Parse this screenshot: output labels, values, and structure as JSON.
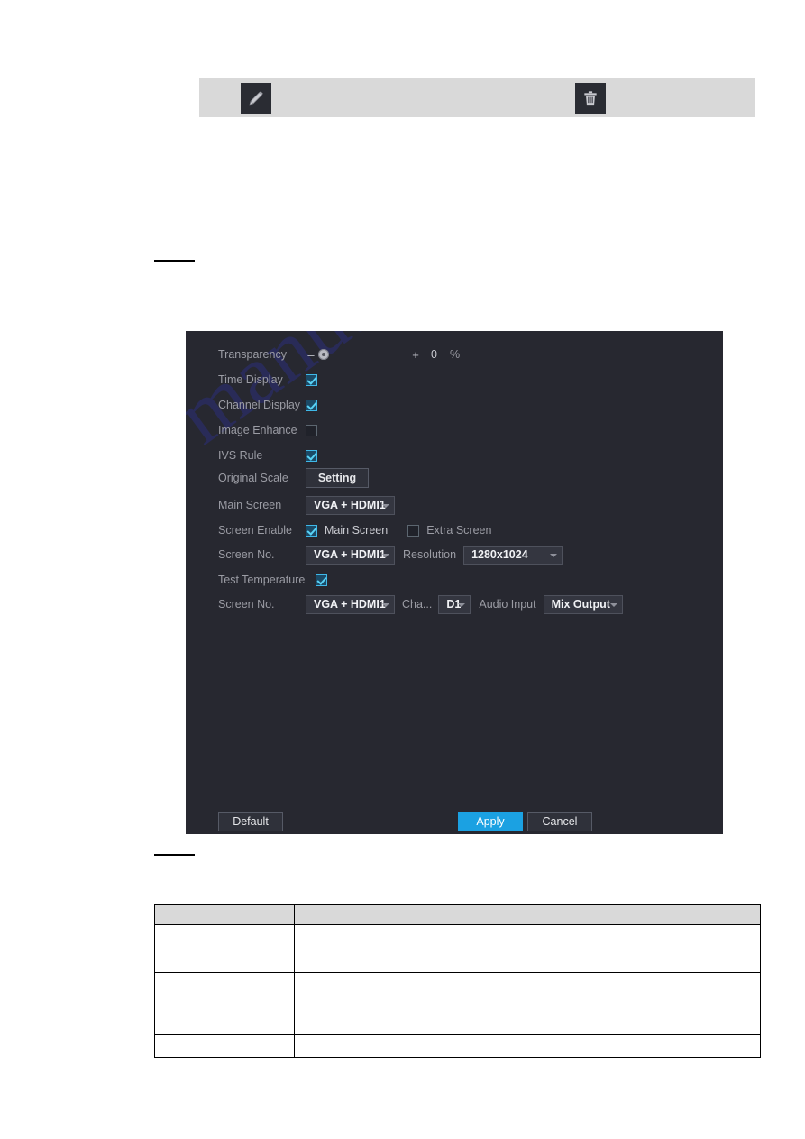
{
  "toolbar": {
    "edit_icon": "pencil-icon",
    "delete_icon": "trash-icon",
    "edit_label": "",
    "delete_label": ""
  },
  "dialog": {
    "rows": {
      "transparency": {
        "label": "Transparency",
        "minus": "–",
        "plus": "+",
        "value": "0",
        "unit": "%"
      },
      "time_display": {
        "label": "Time Display",
        "checked": true
      },
      "channel_display": {
        "label": "Channel Display",
        "checked": true
      },
      "image_enhance": {
        "label": "Image Enhance",
        "checked": false
      },
      "ivs_rule": {
        "label": "IVS Rule",
        "checked": true
      },
      "original_scale": {
        "label": "Original Scale",
        "button": "Setting"
      },
      "main_screen": {
        "label": "Main Screen",
        "value": "VGA + HDMI1"
      },
      "screen_enable": {
        "label": "Screen Enable",
        "main_label": "Main Screen",
        "main_checked": true,
        "extra_label": "Extra Screen",
        "extra_checked": false
      },
      "screen_no_1": {
        "label": "Screen No.",
        "value": "VGA + HDMI1",
        "resolution_label": "Resolution",
        "resolution_value": "1280x1024"
      },
      "test_temperature": {
        "label": "Test Temperature",
        "checked": true
      },
      "screen_no_2": {
        "label": "Screen No.",
        "value": "VGA + HDMI1",
        "channel_label": "Cha...",
        "channel_value": "D1",
        "audio_label": "Audio Input",
        "audio_value": "Mix Output"
      }
    },
    "footer": {
      "default": "Default",
      "apply": "Apply",
      "cancel": "Cancel"
    },
    "watermark": "manualshive.com",
    "colors": {
      "background": "#272830",
      "accent": "#1ba1e2",
      "checkbox_on": "#3fb8e8",
      "label": "#9b9ca4",
      "watermark": "#2b2f7a"
    }
  },
  "table": {
    "header": [
      "",
      ""
    ],
    "rows": [
      [
        "",
        ""
      ],
      [
        "",
        ""
      ],
      [
        "",
        ""
      ]
    ]
  }
}
